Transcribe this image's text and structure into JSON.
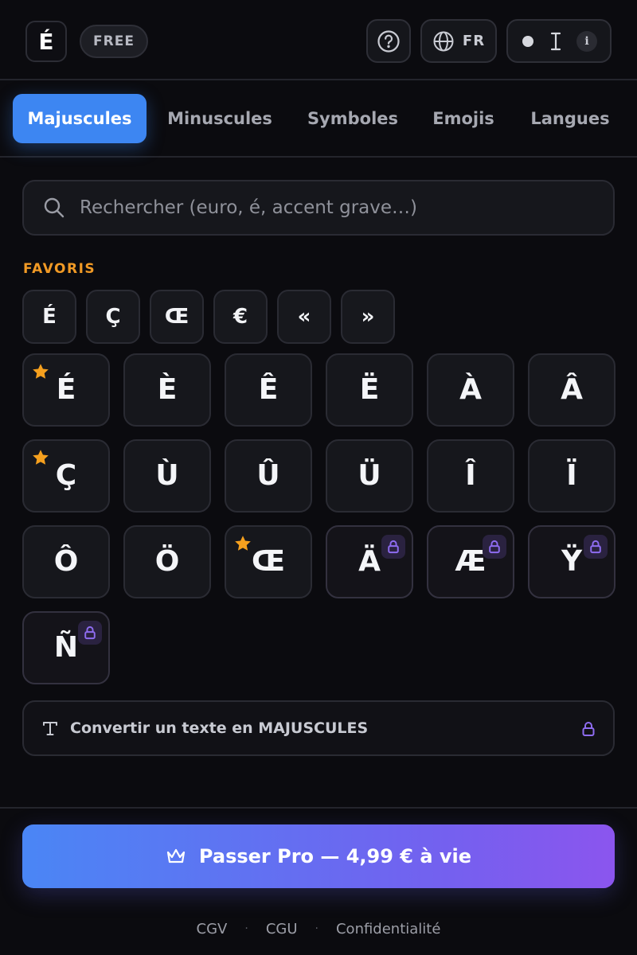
{
  "header": {
    "logo_char": "É",
    "plan_badge": "FREE",
    "language": "FR",
    "help_icon": "question-circle-icon",
    "language_icon": "globe-icon",
    "font_toggle_icons": [
      "dot-icon",
      "text-cursor-icon",
      "info-icon"
    ],
    "info_glyph": "i"
  },
  "tabs": [
    {
      "label": "Majuscules",
      "active": true
    },
    {
      "label": "Minuscules",
      "active": false
    },
    {
      "label": "Symboles",
      "active": false
    },
    {
      "label": "Emojis",
      "active": false
    },
    {
      "label": "Langues",
      "active": false
    }
  ],
  "search": {
    "placeholder": "Rechercher (euro, é, accent grave…)",
    "value": ""
  },
  "favorites": {
    "heading": "FAVORIS",
    "items": [
      "É",
      "Ç",
      "Œ",
      "€",
      "«",
      "»"
    ]
  },
  "characters": [
    {
      "char": "É",
      "favorite": true,
      "locked": false
    },
    {
      "char": "È",
      "favorite": false,
      "locked": false
    },
    {
      "char": "Ê",
      "favorite": false,
      "locked": false
    },
    {
      "char": "Ë",
      "favorite": false,
      "locked": false
    },
    {
      "char": "À",
      "favorite": false,
      "locked": false
    },
    {
      "char": "Â",
      "favorite": false,
      "locked": false
    },
    {
      "char": "Ç",
      "favorite": true,
      "locked": false
    },
    {
      "char": "Ù",
      "favorite": false,
      "locked": false
    },
    {
      "char": "Û",
      "favorite": false,
      "locked": false
    },
    {
      "char": "Ü",
      "favorite": false,
      "locked": false
    },
    {
      "char": "Î",
      "favorite": false,
      "locked": false
    },
    {
      "char": "Ï",
      "favorite": false,
      "locked": false
    },
    {
      "char": "Ô",
      "favorite": false,
      "locked": false
    },
    {
      "char": "Ö",
      "favorite": false,
      "locked": false
    },
    {
      "char": "Œ",
      "favorite": true,
      "locked": false
    },
    {
      "char": "Ä",
      "favorite": false,
      "locked": true
    },
    {
      "char": "Æ",
      "favorite": false,
      "locked": true
    },
    {
      "char": "Ÿ",
      "favorite": false,
      "locked": true
    },
    {
      "char": "Ñ",
      "favorite": false,
      "locked": true
    }
  ],
  "convert": {
    "label": "Convertir un texte en MAJUSCULES",
    "locked": true
  },
  "pro_button": {
    "label": "Passer Pro — 4,99 € à vie"
  },
  "footer_links": [
    "CGV",
    "CGU",
    "Confidentialité"
  ],
  "colors": {
    "background": "#0b0b0f",
    "accent_blue": "#3d86f2",
    "favorites_orange": "#f19a25",
    "star": "#f5a01e",
    "lock_purple": "#8e6cf0",
    "gradient_start": "#4a86f5",
    "gradient_end": "#8b55ee"
  }
}
